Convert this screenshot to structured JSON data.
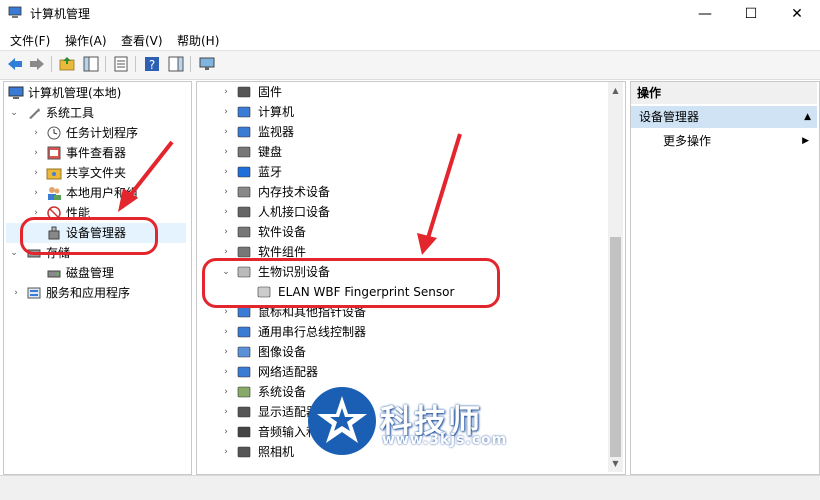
{
  "window": {
    "title": "计算机管理",
    "minimize": "—",
    "maximize": "☐",
    "close": "✕"
  },
  "menu": [
    "文件(F)",
    "操作(A)",
    "查看(V)",
    "帮助(H)"
  ],
  "left_tree": {
    "root": "计算机管理(本地)",
    "system_tools": "系统工具",
    "items": [
      "任务计划程序",
      "事件查看器",
      "共享文件夹",
      "本地用户和组",
      "性能",
      "设备管理器"
    ],
    "storage": "存储",
    "disk_management": "磁盘管理",
    "services": "服务和应用程序"
  },
  "device_tree": {
    "items": [
      "固件",
      "计算机",
      "监视器",
      "键盘",
      "蓝牙",
      "内存技术设备",
      "人机接口设备",
      "软件设备",
      "软件组件"
    ],
    "expanded_category": "生物识别设备",
    "expanded_child": "ELAN WBF Fingerprint Sensor",
    "items_after": [
      "鼠标和其他指针设备",
      "通用串行总线控制器",
      "图像设备",
      "网络适配器",
      "系统设备",
      "显示适配器",
      "音频输入和输出",
      "照相机"
    ]
  },
  "actions": {
    "header": "操作",
    "section": "设备管理器",
    "more": "更多操作"
  },
  "watermark": {
    "text": "科技师",
    "url": "www.3kjs.com"
  },
  "colors": {
    "accent_red": "#e3262d",
    "selection": "#cfe3f4",
    "watermark_blue": "#1a5fb4"
  }
}
